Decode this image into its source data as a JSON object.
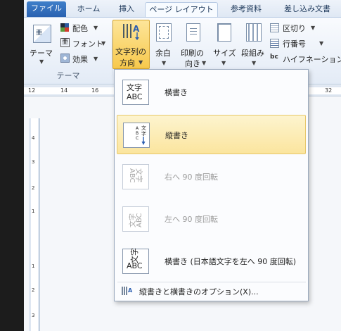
{
  "tabs": {
    "file": "ファイル",
    "home": "ホーム",
    "insert": "挿入",
    "page_layout": "ページ レイアウト",
    "references": "参考資料",
    "mailings": "差し込み文書"
  },
  "ribbon": {
    "themes": "テーマ",
    "colors": "配色",
    "fonts": "フォント",
    "effects": "効果",
    "group_themes": "テーマ",
    "text_direction_l1": "文字列の",
    "text_direction_l2": "方向",
    "margins": "余白",
    "orientation_l1": "印刷の",
    "orientation_l2": "向き",
    "size": "サイズ",
    "columns": "段組み",
    "breaks": "区切り",
    "line_numbers": "行番号",
    "hyphenation": "ハイフネーション"
  },
  "ruler": {
    "h_ticks": [
      "12",
      "14",
      "16",
      "32"
    ],
    "v_ticks": [
      "4",
      "3",
      "2",
      "1",
      "1",
      "2",
      "3"
    ]
  },
  "menu": {
    "items": [
      {
        "label": "横書き",
        "icon_top": "文字",
        "icon_bottom": "ABC"
      },
      {
        "label": "縦書き"
      },
      {
        "label": "右へ 90 度回転",
        "icon_top": "文字",
        "icon_bottom": "ABC"
      },
      {
        "label": "左へ 90 度回転",
        "icon_top": "文字",
        "icon_bottom": "ABC"
      },
      {
        "label": "横書き (日本語文字を左へ 90 度回転)",
        "icon_top": "文字",
        "icon_bottom": "ABC"
      }
    ],
    "footer": "縦書きと横書きのオプション(X)..."
  },
  "colors": {
    "accent_tab": "#2a62b1",
    "highlight": "#fbe59e",
    "ribbon_bg": "#e3ebf6"
  }
}
